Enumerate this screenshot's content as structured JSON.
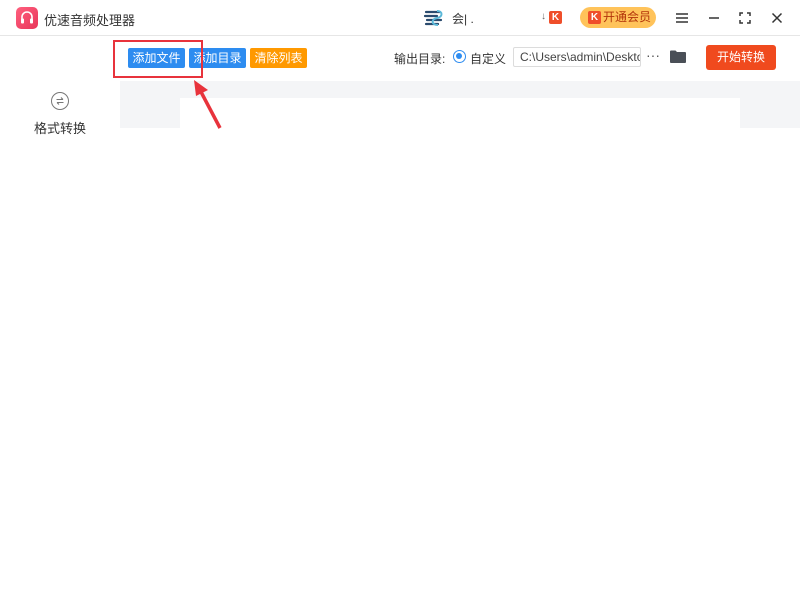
{
  "titlebar": {
    "app_title": "优速音频处理器",
    "user_name": "会| .",
    "vip_label": "开通会员",
    "k_badge": "K"
  },
  "sidebar": {
    "items": [
      {
        "label": "格式转换"
      }
    ]
  },
  "toolbar": {
    "add_file": "添加文件",
    "add_dir": "添加目录",
    "clear_list": "清除列表",
    "output_label": "输出目录:",
    "custom_label": "自定义",
    "output_path": "C:\\Users\\admin\\Deskto",
    "more": "···",
    "start": "开始转换"
  },
  "colors": {
    "accent_blue": "#2d8cf0",
    "clear_orange": "#ff9900",
    "start_red": "#f04a1e",
    "vip_gold": "#ffc35a",
    "annotation_red": "#e8333c"
  },
  "icons": [
    "app-logo-icon",
    "user-logo-icon",
    "menu-icon",
    "minimize-icon",
    "maximize-icon",
    "close-icon",
    "format-convert-icon",
    "folder-icon"
  ]
}
